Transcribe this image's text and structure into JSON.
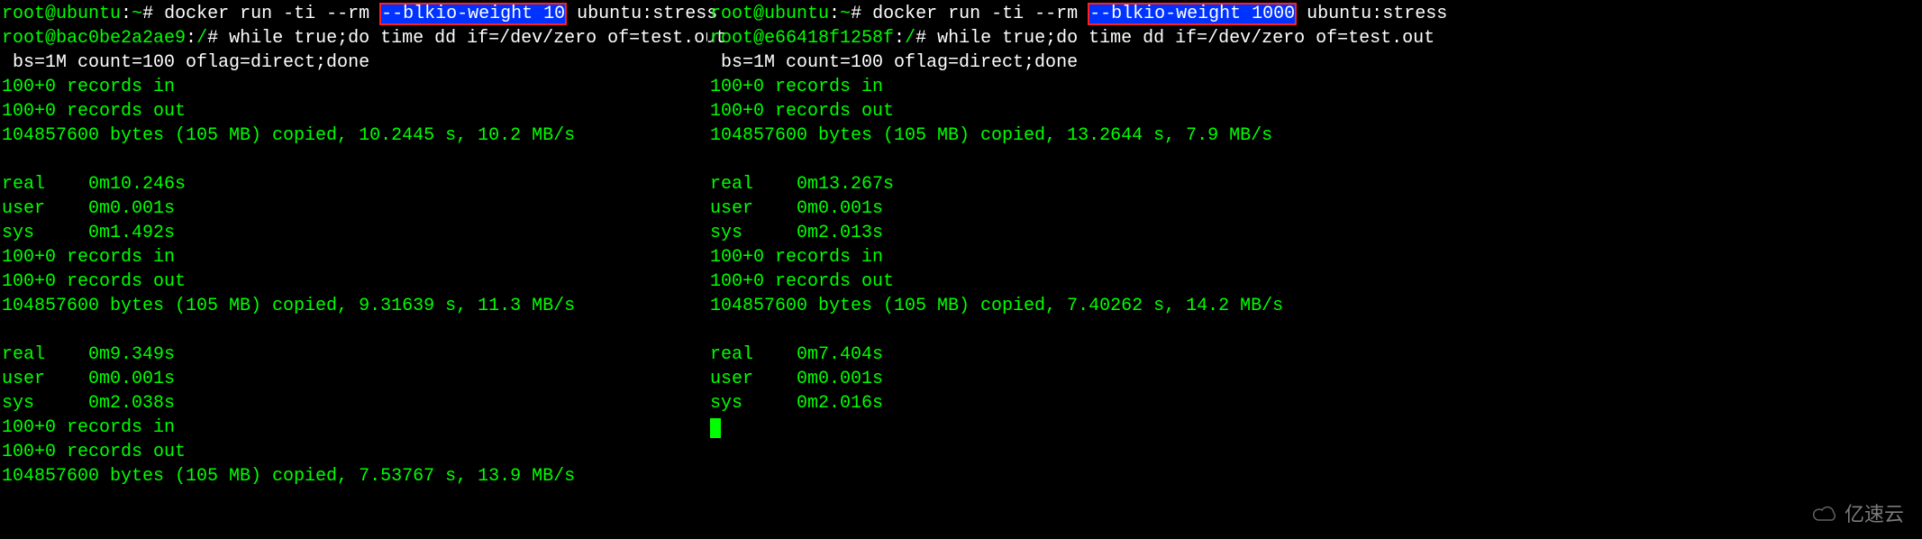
{
  "left": {
    "prompt1_user": "root@ubuntu",
    "prompt1_sep": ":",
    "prompt1_path": "~",
    "prompt1_hash": "# ",
    "cmd1_pre": "docker run -ti --rm ",
    "cmd1_hl": "--blkio-weight 10",
    "cmd1_post": " ubuntu:stress",
    "prompt2_user": "root@bac0be2a2ae9",
    "prompt2_sep": ":",
    "prompt2_path": "/",
    "prompt2_hash": "# ",
    "cmd2a": "while true;do time dd if=/dev/zero of=test.out",
    "cmd2b": " bs=1M count=100 oflag=direct;done",
    "run1": {
      "rec_in": "100+0 records in",
      "rec_out": "100+0 records out",
      "copied": "104857600 bytes (105 MB) copied, 10.2445 s, 10.2 MB/s",
      "real": "real    0m10.246s",
      "user": "user    0m0.001s",
      "sys": "sys     0m1.492s"
    },
    "run2": {
      "rec_in": "100+0 records in",
      "rec_out": "100+0 records out",
      "copied": "104857600 bytes (105 MB) copied, 9.31639 s, 11.3 MB/s",
      "real": "real    0m9.349s",
      "user": "user    0m0.001s",
      "sys": "sys     0m2.038s"
    },
    "run3": {
      "rec_in": "100+0 records in",
      "rec_out": "100+0 records out",
      "copied": "104857600 bytes (105 MB) copied, 7.53767 s, 13.9 MB/s"
    }
  },
  "right": {
    "prompt1_user": "root@ubuntu",
    "prompt1_sep": ":",
    "prompt1_path": "~",
    "prompt1_hash": "# ",
    "cmd1_pre": "docker run -ti --rm ",
    "cmd1_hl": "--blkio-weight 1000",
    "cmd1_post": " ubuntu:stress",
    "prompt2_user": "root@e66418f1258f",
    "prompt2_sep": ":",
    "prompt2_path": "/",
    "prompt2_hash": "# ",
    "cmd2a": "while true;do time dd if=/dev/zero of=test.out",
    "cmd2b": " bs=1M count=100 oflag=direct;done",
    "run1": {
      "rec_in": "100+0 records in",
      "rec_out": "100+0 records out",
      "copied": "104857600 bytes (105 MB) copied, 13.2644 s, 7.9 MB/s",
      "real": "real    0m13.267s",
      "user": "user    0m0.001s",
      "sys": "sys     0m2.013s"
    },
    "run2": {
      "rec_in": "100+0 records in",
      "rec_out": "100+0 records out",
      "copied": "104857600 bytes (105 MB) copied, 7.40262 s, 14.2 MB/s",
      "real": "real    0m7.404s",
      "user": "user    0m0.001s",
      "sys": "sys     0m2.016s"
    }
  },
  "watermark": "亿速云"
}
